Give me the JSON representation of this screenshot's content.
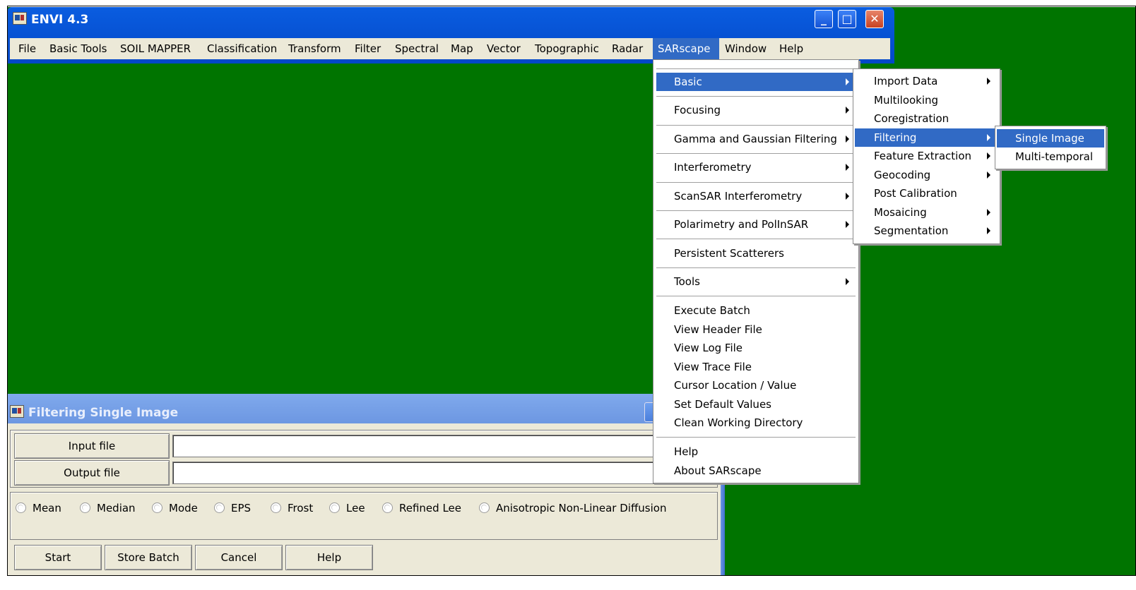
{
  "colors": {
    "desktop": "#007400",
    "titlebar": "#0348c8",
    "menu_highlight": "#316ac5",
    "window_face": "#ece9d8",
    "inactive_titlebar": "#7fa9ec"
  },
  "main_window": {
    "title": "ENVI 4.3",
    "controls": [
      "minimize",
      "maximize",
      "close"
    ],
    "menubar": [
      "File",
      "Basic Tools",
      "SOIL MAPPER",
      "Classification",
      "Transform",
      "Filter",
      "Spectral",
      "Map",
      "Vector",
      "Topographic",
      "Radar",
      "SARscape",
      "Window",
      "Help"
    ],
    "active_menu": "SARscape"
  },
  "sarscape_menu": {
    "items": [
      "Basic",
      "Focusing",
      "Gamma and Gaussian Filtering",
      "Interferometry",
      "ScanSAR Interferometry",
      "Polarimetry and PolInSAR",
      "Persistent Scatterers",
      "Tools",
      "Execute Batch",
      "View Header File",
      "View Log File",
      "View Trace File",
      "Cursor Location / Value",
      "Set Default Values",
      "Clean Working Directory",
      "Help",
      "About SARscape"
    ],
    "active": "Basic"
  },
  "basic_menu": {
    "items": [
      "Import Data",
      "Multilooking",
      "Coregistration",
      "Filtering",
      "Feature Extraction",
      "Geocoding",
      "Post Calibration",
      "Mosaicing",
      "Segmentation"
    ],
    "active": "Filtering"
  },
  "filtering_menu": {
    "items": [
      "Single Image",
      "Multi-temporal"
    ],
    "active": "Single Image"
  },
  "dialog": {
    "title": "Filtering Single Image",
    "input_label": "Input file",
    "input_value": "",
    "output_label": "Output file",
    "output_value": "",
    "filters": [
      "Mean",
      "Median",
      "Mode",
      "EPS",
      "Frost",
      "Lee",
      "Refined Lee",
      "Anisotropic Non-Linear Diffusion"
    ],
    "buttons": [
      "Start",
      "Store Batch",
      "Cancel",
      "Help"
    ]
  }
}
